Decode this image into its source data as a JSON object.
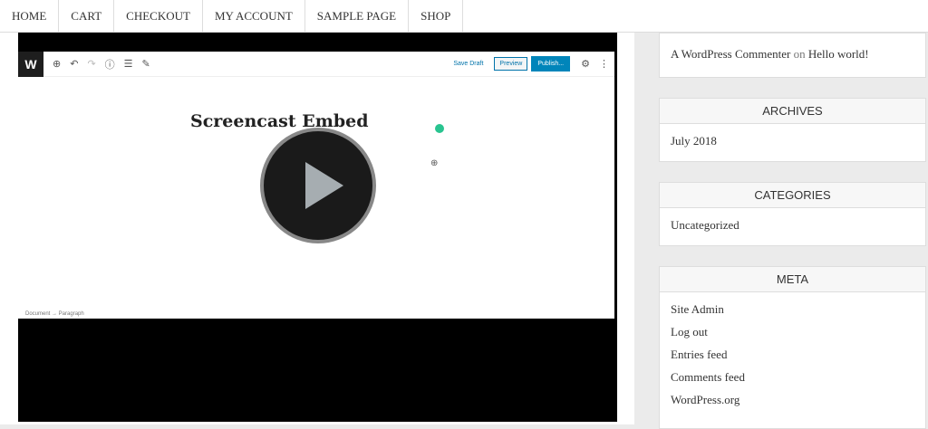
{
  "nav": [
    "HOME",
    "CART",
    "CHECKOUT",
    "MY ACCOUNT",
    "SAMPLE PAGE",
    "SHOP"
  ],
  "editor": {
    "logo": "W",
    "save_draft": "Save Draft",
    "preview": "Preview",
    "publish": "Publish...",
    "post_title": "Screencast Embed",
    "breadcrumb": "Document → Paragraph"
  },
  "sidebar": {
    "recent_comment": {
      "author": "A WordPress Commenter",
      "on": "on",
      "post": "Hello world!"
    },
    "archives": {
      "title": "ARCHIVES",
      "items": [
        "July 2018"
      ]
    },
    "categories": {
      "title": "CATEGORIES",
      "items": [
        "Uncategorized"
      ]
    },
    "meta": {
      "title": "META",
      "items": [
        "Site Admin",
        "Log out",
        "Entries feed",
        "Comments feed",
        "WordPress.org"
      ]
    }
  }
}
